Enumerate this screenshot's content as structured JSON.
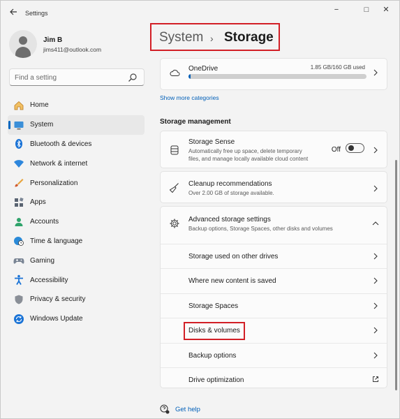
{
  "window": {
    "title": "Settings",
    "back_icon": "back-arrow-icon",
    "minimize": "−",
    "maximize": "□",
    "close": "✕"
  },
  "profile": {
    "name": "Jim B",
    "email": "jims411@outlook.com"
  },
  "search": {
    "placeholder": "Find a setting"
  },
  "nav": {
    "items": [
      {
        "label": "Home",
        "icon": "home-icon"
      },
      {
        "label": "System",
        "icon": "system-icon",
        "active": true
      },
      {
        "label": "Bluetooth & devices",
        "icon": "bluetooth-icon"
      },
      {
        "label": "Network & internet",
        "icon": "wifi-icon"
      },
      {
        "label": "Personalization",
        "icon": "brush-icon"
      },
      {
        "label": "Apps",
        "icon": "apps-icon"
      },
      {
        "label": "Accounts",
        "icon": "accounts-icon"
      },
      {
        "label": "Time & language",
        "icon": "globe-clock-icon"
      },
      {
        "label": "Gaming",
        "icon": "gamepad-icon"
      },
      {
        "label": "Accessibility",
        "icon": "accessibility-icon"
      },
      {
        "label": "Privacy & security",
        "icon": "shield-icon"
      },
      {
        "label": "Windows Update",
        "icon": "update-icon"
      }
    ]
  },
  "header": {
    "parent": "System",
    "separator": "›",
    "current": "Storage"
  },
  "onedrive": {
    "title": "OneDrive",
    "usage": "1.85 GB/160 GB used",
    "used_fraction": 0.012
  },
  "links": {
    "show_more": "Show more categories",
    "get_help": "Get help"
  },
  "storage_management": {
    "title": "Storage management",
    "storage_sense": {
      "title": "Storage Sense",
      "desc_line1": "Automatically free up space, delete temporary",
      "desc_line2": "files, and manage locally available cloud content",
      "toggle_label": "Off"
    },
    "cleanup": {
      "title": "Cleanup recommendations",
      "desc": "Over 2.00 GB of storage available."
    },
    "advanced": {
      "title": "Advanced storage settings",
      "desc": "Backup options, Storage Spaces, other disks and volumes",
      "items": [
        {
          "label": "Storage used on other drives"
        },
        {
          "label": "Where new content is saved"
        },
        {
          "label": "Storage Spaces"
        },
        {
          "label": "Disks & volumes"
        },
        {
          "label": "Backup options"
        },
        {
          "label": "Drive optimization"
        }
      ]
    }
  },
  "colors": {
    "accent": "#005fb8",
    "highlight": "#d21f26"
  }
}
